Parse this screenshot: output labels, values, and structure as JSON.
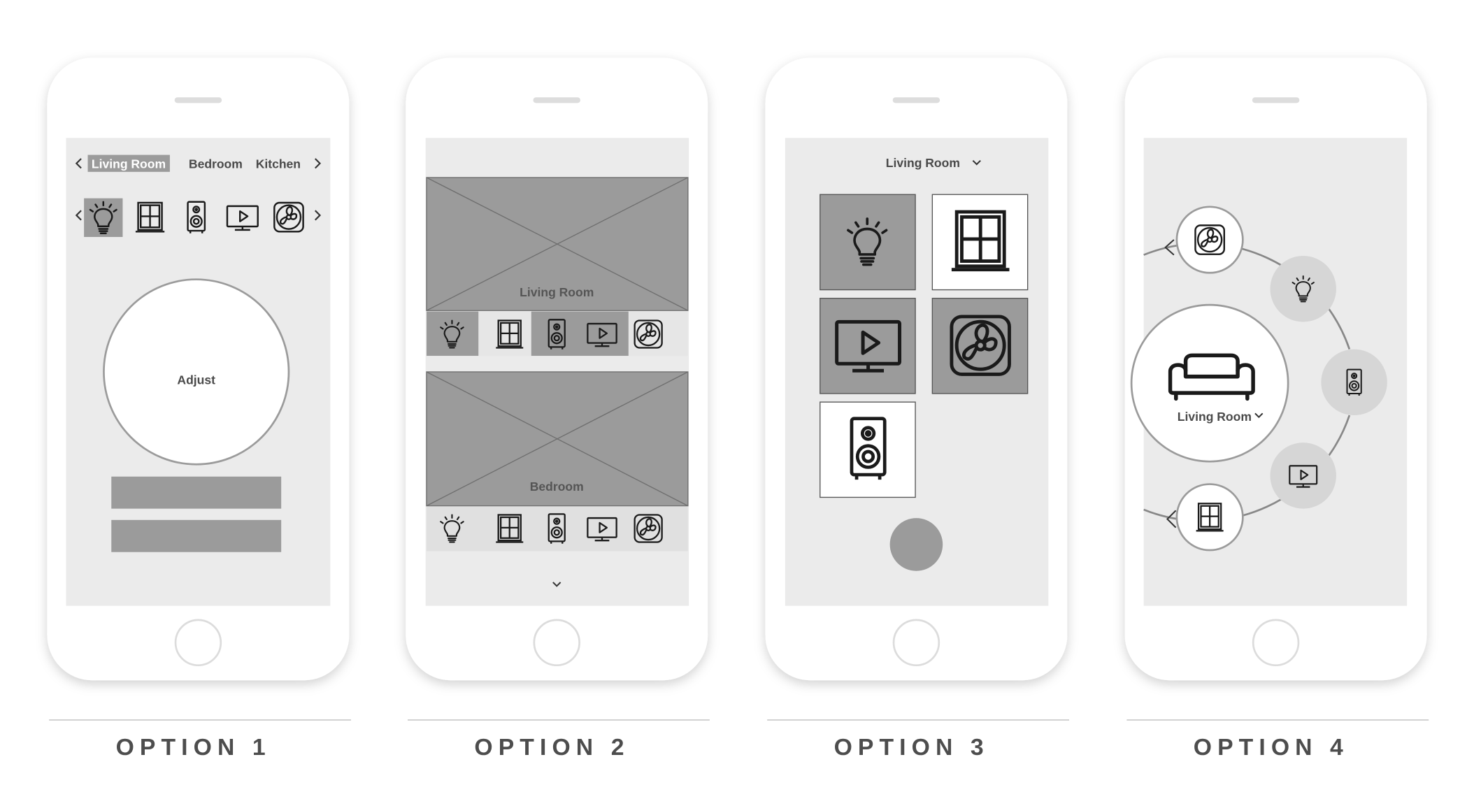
{
  "options": [
    {
      "caption": "OPTION 1"
    },
    {
      "caption": "OPTION 2"
    },
    {
      "caption": "OPTION 3"
    },
    {
      "caption": "OPTION 4"
    }
  ],
  "option1": {
    "rooms": [
      "Living Room",
      "Bedroom",
      "Kitchen"
    ],
    "devices": [
      "lightbulb-icon",
      "window-icon",
      "speaker-icon",
      "tv-icon",
      "fan-icon"
    ],
    "dial_label": "Adjust"
  },
  "option2": {
    "cards": [
      {
        "room": "Living Room"
      },
      {
        "room": "Bedroom"
      }
    ],
    "devices": [
      "lightbulb-icon",
      "window-icon",
      "speaker-icon",
      "tv-icon",
      "fan-icon"
    ]
  },
  "option3": {
    "room_selector": "Living Room",
    "tiles": [
      "lightbulb-icon",
      "window-icon",
      "tv-icon",
      "fan-icon",
      "speaker-icon"
    ]
  },
  "option4": {
    "room": "Living Room",
    "center_icon": "sofa-icon",
    "orbit": [
      "fan-icon",
      "lightbulb-icon",
      "speaker-icon",
      "tv-icon",
      "window-icon"
    ]
  },
  "colors": {
    "screen": "#ebebeb",
    "placeholder": "#9b9b9b",
    "icon": "#1a1a1a",
    "text": "#4a4a4a",
    "divider": "#bdbdbd"
  }
}
